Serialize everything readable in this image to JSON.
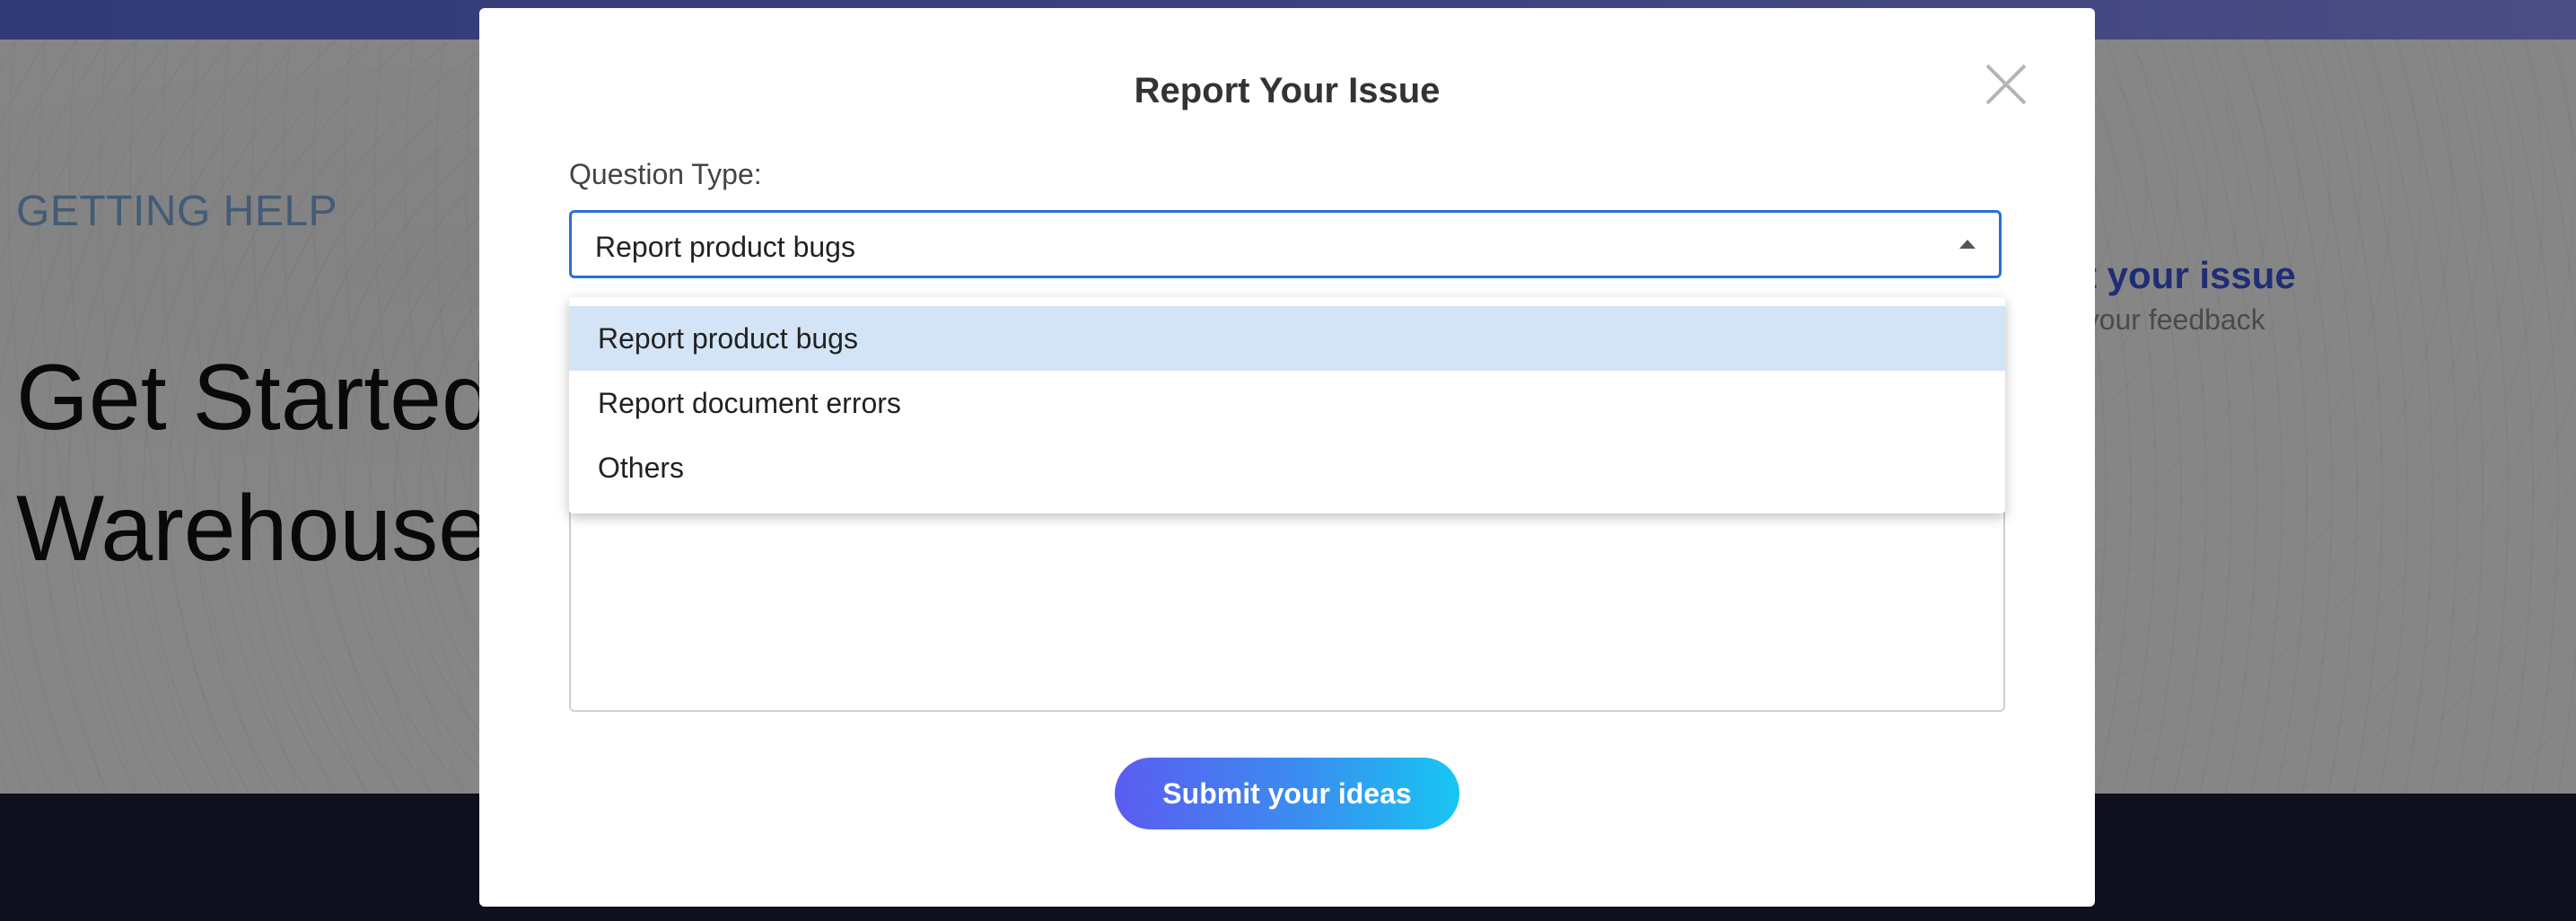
{
  "background": {
    "kicker": "GETTING HELP",
    "title_line1": "Get Started",
    "title_line2": "Warehouses",
    "side_link": "ort your issue",
    "side_sub": "us your feedback"
  },
  "modal": {
    "title": "Report Your Issue",
    "close_icon": "close-icon",
    "question_type_label": "Question Type:",
    "selected_value": "Report product bugs",
    "options": [
      {
        "label": "Report product bugs",
        "highlighted": true
      },
      {
        "label": "Report document errors",
        "highlighted": false
      },
      {
        "label": "Others",
        "highlighted": false
      }
    ],
    "description_value": "",
    "submit_label": "Submit your ideas"
  },
  "colors": {
    "accent": "#2a6fd6",
    "option_highlight": "#d3e4f6",
    "button_gradient_start": "#5b5cf0",
    "button_gradient_end": "#17c6f2",
    "footer": "#1c1d36"
  }
}
